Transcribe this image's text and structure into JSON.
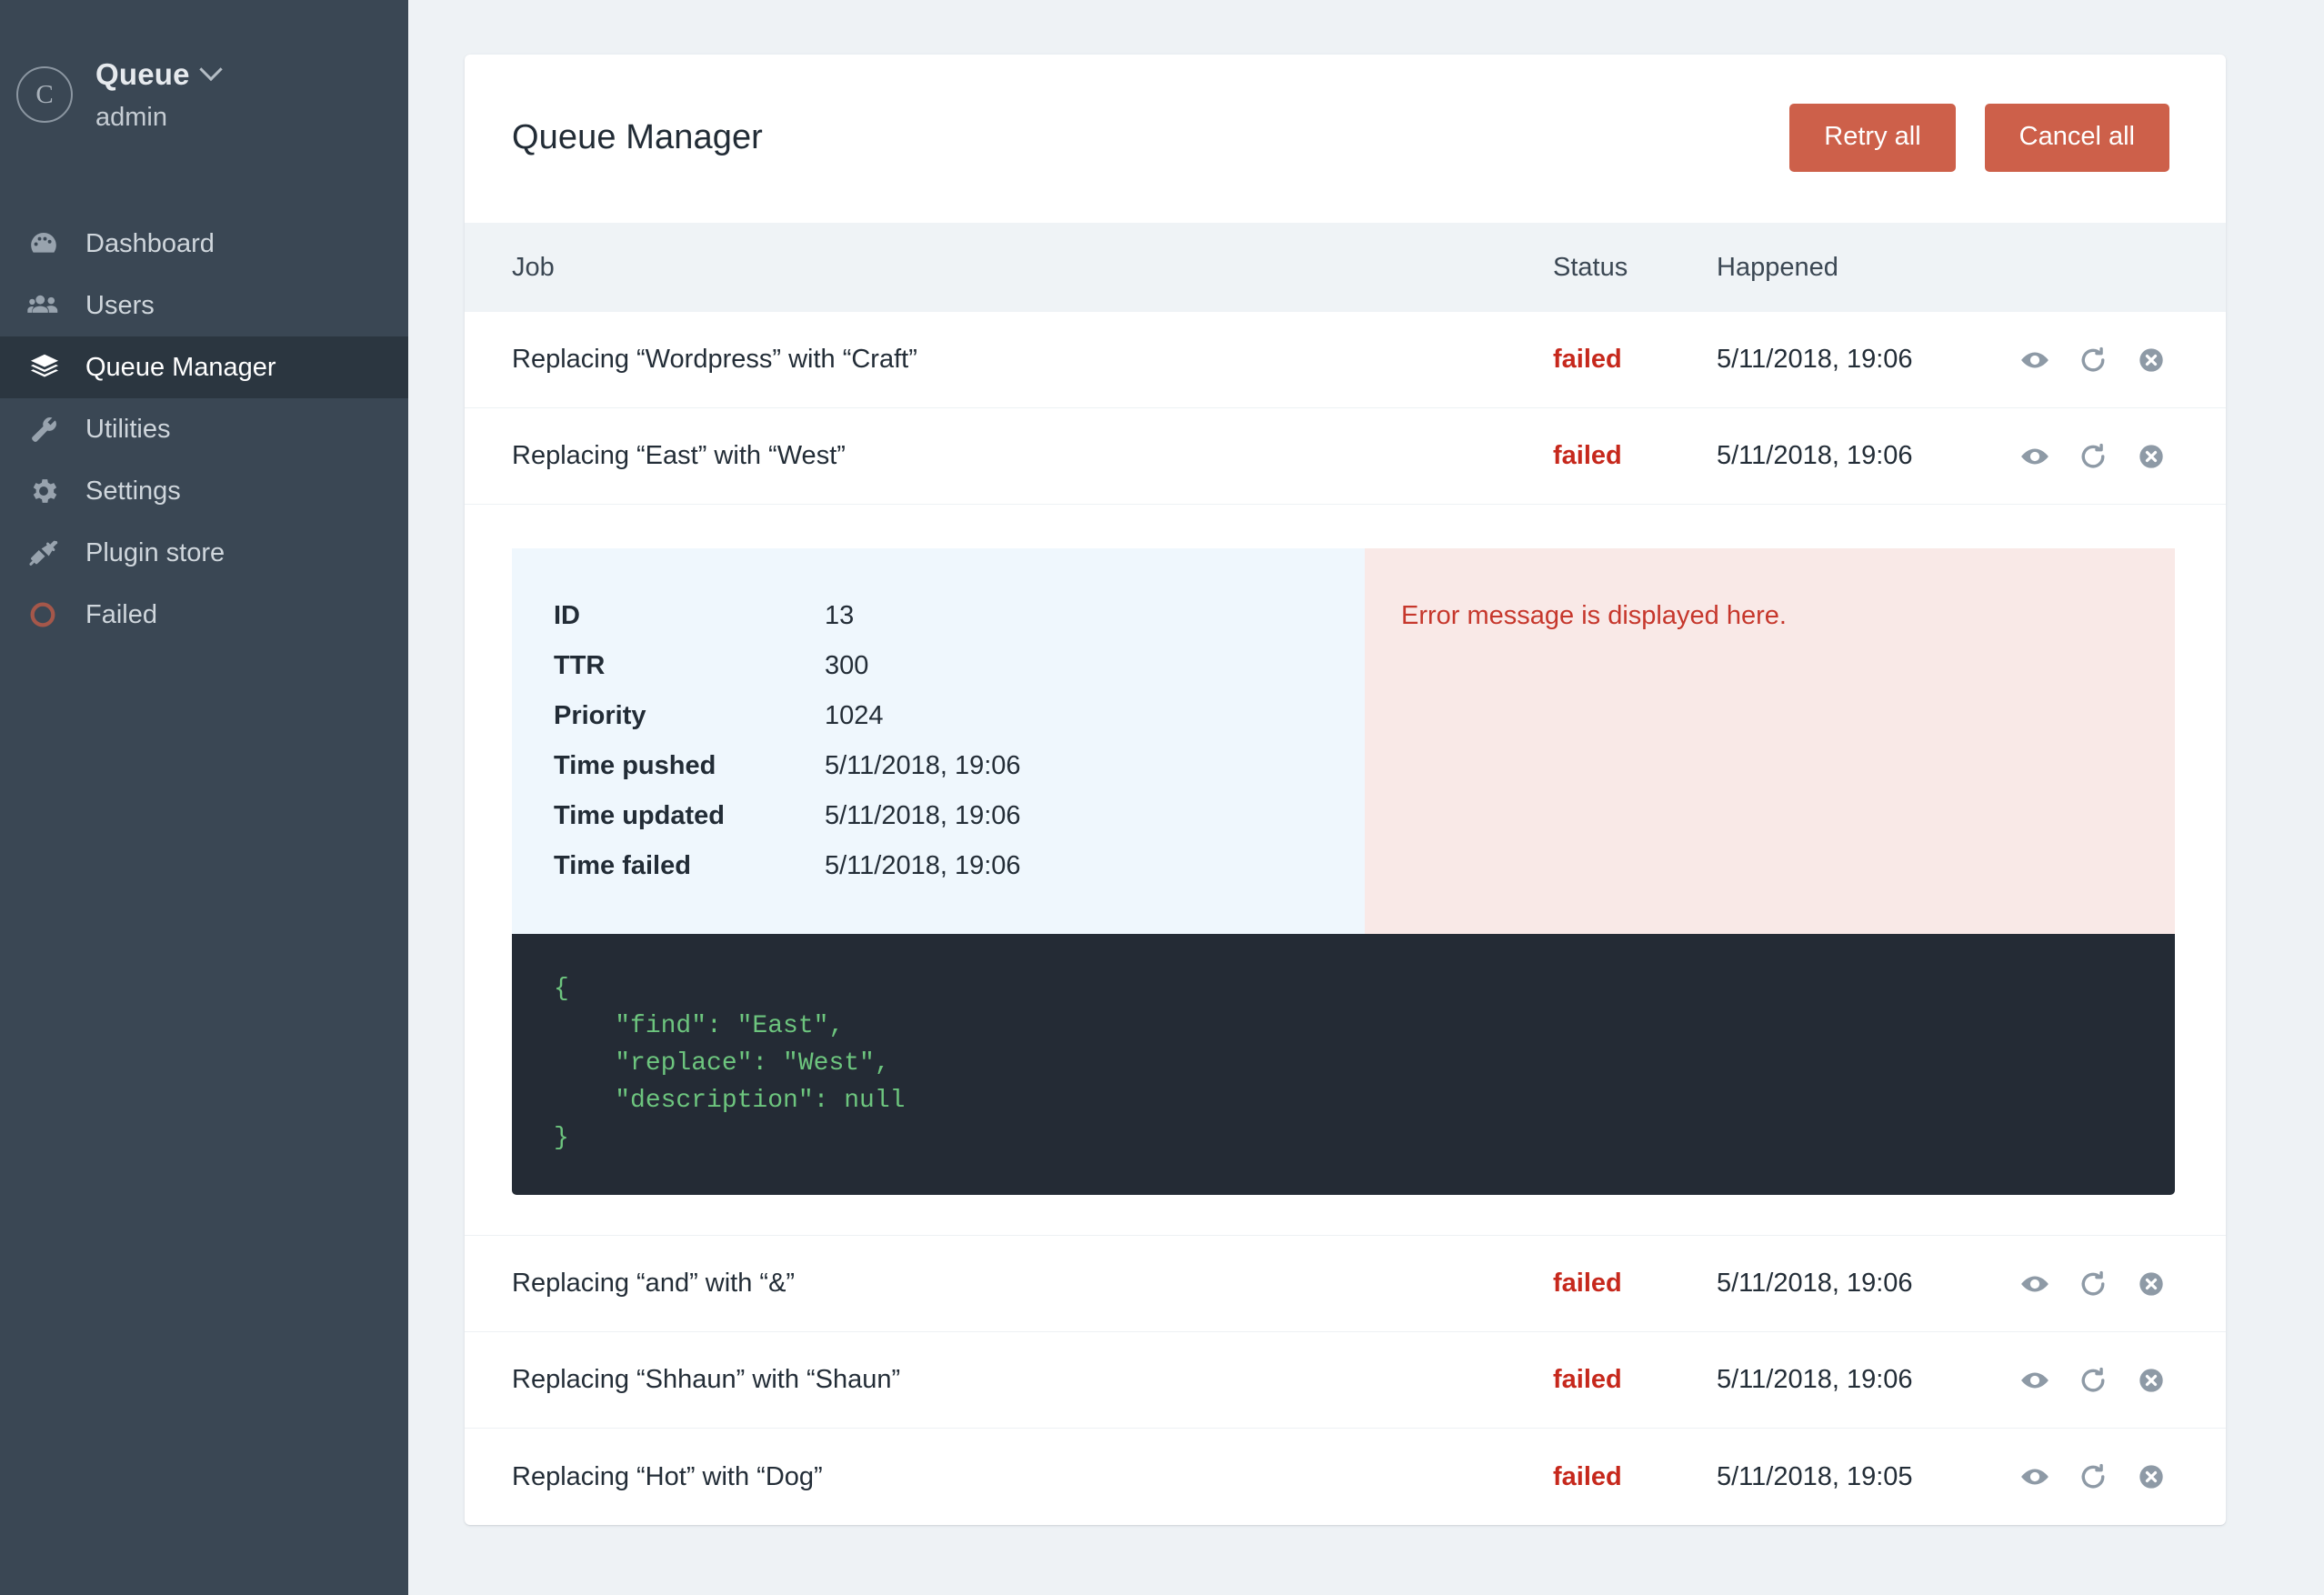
{
  "sidebar": {
    "user": {
      "avatar_initial": "C",
      "name": "Queue",
      "role": "admin",
      "chevron_icon": "chevron-down-icon"
    },
    "items": [
      {
        "label": "Dashboard",
        "icon": "gauge-icon",
        "active": false
      },
      {
        "label": "Users",
        "icon": "users-icon",
        "active": false
      },
      {
        "label": "Queue Manager",
        "icon": "layers-icon",
        "active": true
      },
      {
        "label": "Utilities",
        "icon": "wrench-icon",
        "active": false
      },
      {
        "label": "Settings",
        "icon": "gear-icon",
        "active": false
      },
      {
        "label": "Plugin store",
        "icon": "plug-icon",
        "active": false
      },
      {
        "label": "Failed",
        "icon": "circle-error-icon",
        "active": false
      }
    ]
  },
  "header": {
    "title": "Queue Manager",
    "retry_all_label": "Retry all",
    "cancel_all_label": "Cancel all"
  },
  "table": {
    "columns": {
      "job": "Job",
      "status": "Status",
      "happened": "Happened"
    },
    "row_actions": {
      "view": "eye-icon",
      "retry": "retry-icon",
      "cancel": "cancel-circle-icon"
    },
    "rows": [
      {
        "job": "Replacing “Wordpress” with “Craft”",
        "status": "failed",
        "happened": "5/11/2018, 19:06"
      },
      {
        "job": "Replacing “East” with “West”",
        "status": "failed",
        "happened": "5/11/2018, 19:06"
      },
      {
        "job": "Replacing “and” with “&”",
        "status": "failed",
        "happened": "5/11/2018, 19:06"
      },
      {
        "job": "Replacing “Shhaun” with “Shaun”",
        "status": "failed",
        "happened": "5/11/2018, 19:06"
      },
      {
        "job": "Replacing “Hot” with “Dog”",
        "status": "failed",
        "happened": "5/11/2018, 19:05"
      }
    ]
  },
  "detail": {
    "fields": [
      {
        "key": "ID",
        "value": "13"
      },
      {
        "key": "TTR",
        "value": "300"
      },
      {
        "key": "Priority",
        "value": "1024"
      },
      {
        "key": "Time pushed",
        "value": "5/11/2018, 19:06"
      },
      {
        "key": "Time updated",
        "value": "5/11/2018, 19:06"
      },
      {
        "key": "Time failed",
        "value": "5/11/2018, 19:06"
      }
    ],
    "error_message": "Error message is displayed here.",
    "payload": "{\n    \"find\": \"East\",\n    \"replace\": \"West\",\n    \"description\": null\n}"
  },
  "colors": {
    "accent_button": "#cd604a",
    "status_failed": "#c6281c",
    "sidebar_bg": "#3a4754",
    "sidebar_active_bg": "#2b3640",
    "detail_left_bg": "#eff7fd",
    "detail_right_bg": "#f9e9e7",
    "code_bg": "#242b35",
    "code_text": "#6dc57e",
    "page_bg": "#eef2f5"
  }
}
